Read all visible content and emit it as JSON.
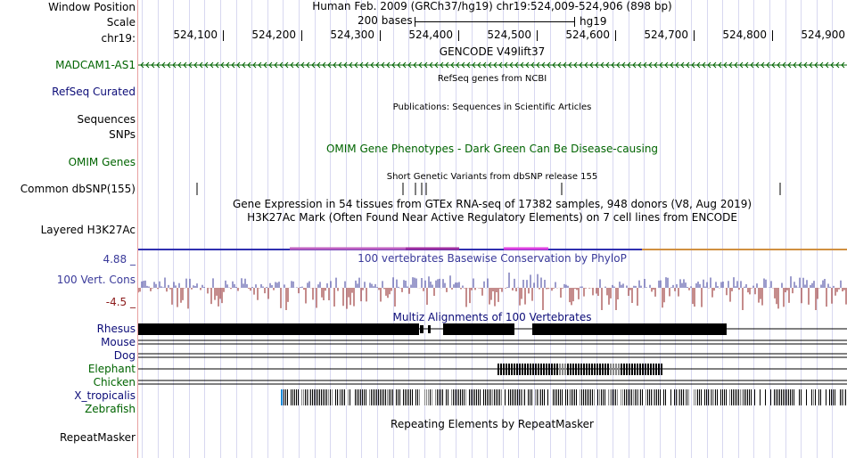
{
  "header": {
    "window_position_label": "Window Position",
    "window_position_value": "Human Feb. 2009 (GRCh37/hg19)   chr19:524,009-524,906 (898 bp)",
    "scale_label": "Scale",
    "scale_text": "200 bases",
    "scale_assembly": "hg19",
    "chrom_label": "chr19:",
    "ruler_ticks": [
      "524,100",
      "524,200",
      "524,300",
      "524,400",
      "524,500",
      "524,600",
      "524,700",
      "524,800",
      "524,900"
    ]
  },
  "tracks": {
    "gencode": {
      "title": "GENCODE V49lift37",
      "label": "MADCAM1-AS1",
      "color": "#006400"
    },
    "refseq": {
      "title": "RefSeq genes from NCBI",
      "label": "RefSeq Curated",
      "color": "#0c0c78"
    },
    "publications": {
      "title": "Publications: Sequences in Scientific Articles",
      "label1": "Sequences",
      "label2": "SNPs"
    },
    "omim": {
      "title": "OMIM Gene Phenotypes - Dark Green Can Be Disease-causing",
      "label": "OMIM Genes",
      "color": "#006400"
    },
    "dbsnp": {
      "title": "Short Genetic Variants from dbSNP release 155",
      "label": "Common dbSNP(155)"
    },
    "gtex": {
      "title": "Gene Expression in 54 tissues from GTEx RNA-seq of 17382 samples, 948 donors (V8, Aug 2019)"
    },
    "h3k27ac": {
      "title": "H3K27Ac Mark (Often Found Near Active Regulatory Elements) on 7 cell lines from ENCODE",
      "label": "Layered H3K27Ac"
    },
    "conservation": {
      "title": "100 vertebrates Basewise Conservation by PhyloP",
      "label": "100 Vert. Cons",
      "max": "4.88 _",
      "min": "-4.5 _",
      "color": "#3a3a9a",
      "neg_color": "#8b1a1a"
    },
    "multiz": {
      "title": "Multiz Alignments of 100 Vertebrates",
      "species": [
        {
          "name": "Rhesus",
          "color": "#0c0c78"
        },
        {
          "name": "Mouse",
          "color": "#0c0c78"
        },
        {
          "name": "Dog",
          "color": "#0c0c78"
        },
        {
          "name": "Elephant",
          "color": "#006400"
        },
        {
          "name": "Chicken",
          "color": "#006400"
        },
        {
          "name": "X_tropicalis",
          "color": "#0c0c78"
        },
        {
          "name": "Zebrafish",
          "color": "#006400"
        }
      ]
    },
    "repeatmasker": {
      "title": "Repeating Elements by RepeatMasker",
      "label": "RepeatMasker"
    }
  }
}
